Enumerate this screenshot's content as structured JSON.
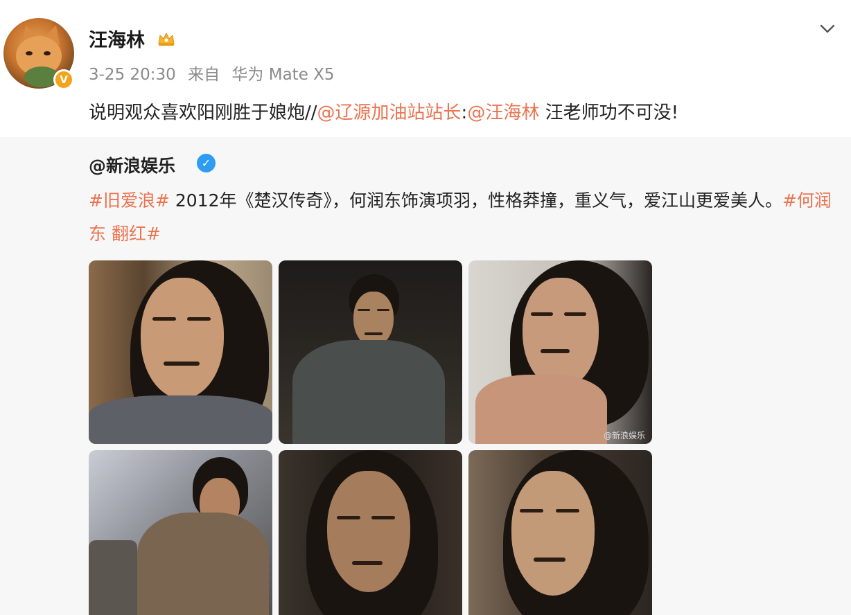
{
  "post": {
    "username": "汪海林",
    "timestamp": "3-25 20:30",
    "source_prefix": "来自",
    "device": "华为 Mate X5",
    "avatar_badge": "V",
    "text_before": "说明观众喜欢阳刚胜于娘炮//",
    "mention_1": "@辽源加油站站长",
    "colon": ":",
    "mention_2": "@汪海林",
    "text_after": " 汪老师功不可没!",
    "accent_color": "#eb7350"
  },
  "quoted": {
    "author": "@新浪娱乐",
    "verified_badge": "✓",
    "tag_1": "#旧爱浪#",
    "body": " 2012年《楚汉传奇》，何润东饰演项羽，性格莽撞，重义气，爱江山更爱美人。",
    "tag_2": "#何润东 翻红#",
    "watermark": "@新浪娱乐"
  },
  "photos": [
    {
      "name": "photo-1",
      "icon": "portrait-image"
    },
    {
      "name": "photo-2",
      "icon": "portrait-image"
    },
    {
      "name": "photo-3",
      "icon": "portrait-image"
    },
    {
      "name": "photo-4",
      "icon": "portrait-image"
    },
    {
      "name": "photo-5",
      "icon": "portrait-image"
    },
    {
      "name": "photo-6",
      "icon": "portrait-image"
    }
  ],
  "icons": {
    "menu": "chevron-down-icon",
    "crown": "crown-icon"
  }
}
